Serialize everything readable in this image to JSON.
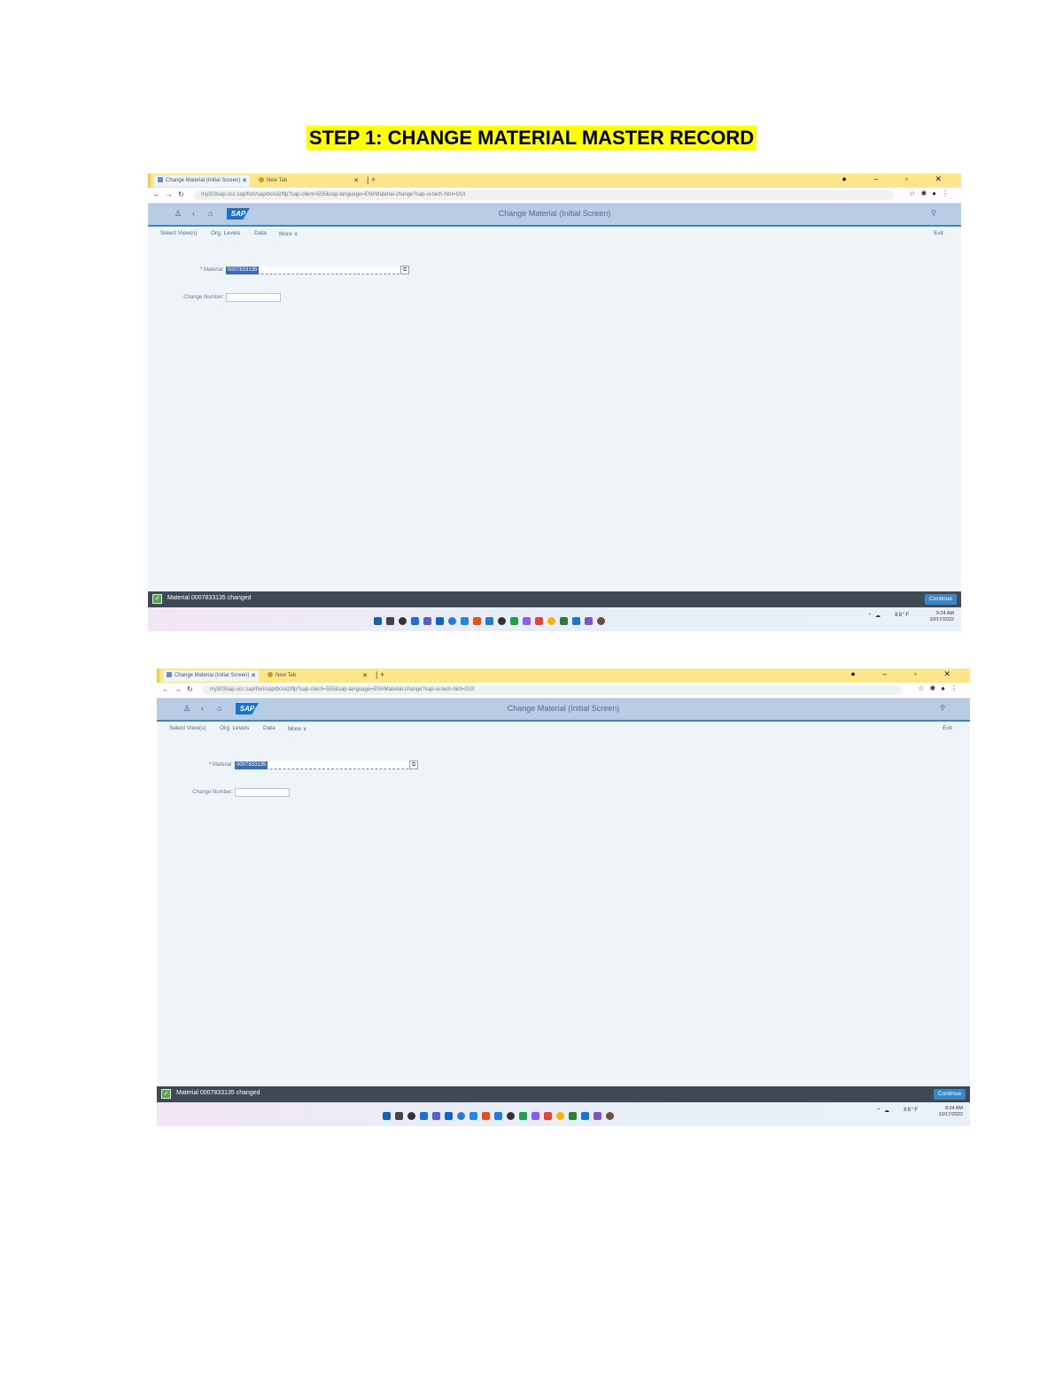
{
  "document": {
    "title": "STEP 1: CHANGE MATERIAL MASTER RECORD"
  },
  "screenshots": [
    {
      "browser": {
        "tab1": "Change Material (Initial Screen)",
        "tab2": "New Tab",
        "url": "my303sap.ucc.sap/fiori/sap/bc/ui2/flp?sap-client=555&sap-language=EN#Material-change?sap-ui-tech-hint=GUI"
      },
      "shell": {
        "title": "Change Material (Initial Screen)",
        "logo": "SAP"
      },
      "menu": {
        "items": [
          "Select View(s)",
          "Org. Levels",
          "Data",
          "More ∨"
        ],
        "exit": "Exit"
      },
      "form": {
        "material_label": "Material:",
        "material_value": "0007833135",
        "change_number_label": "Change Number:",
        "change_number_value": ""
      },
      "message": {
        "text": "Material 0007833135 changed",
        "button": "Continue"
      }
    },
    {
      "browser": {
        "tab1": "Change Material (Initial Screen)",
        "tab2": "New Tab",
        "url": "my303sap.ucc.sap/fiori/sap/bc/ui2/flp?sap-client=555&sap-language=EN#Material-change?sap-ui-tech-hint=GUI"
      },
      "shell": {
        "title": "Change Material (Initial Screen)",
        "logo": "SAP"
      },
      "menu": {
        "items": [
          "Select View(s)",
          "Org. Levels",
          "Data",
          "More ∨"
        ],
        "exit": "Exit"
      },
      "form": {
        "material_label": "Material:",
        "material_value": "0007833135",
        "change_number_label": "Change Number:",
        "change_number_value": ""
      },
      "message": {
        "text": "Material 0007833135 changed",
        "button": "Continue"
      }
    }
  ],
  "taskbar_icon_colors": [
    "#1a5fb4",
    "#444444",
    "#333333",
    "#1e6fd9",
    "#5b5fc7",
    "#0c64c9",
    "#2a7dd6",
    "#1e88e5",
    "#e8501a",
    "#1e7bd9",
    "#333333",
    "#1aa34a",
    "#8b5cf6",
    "#ea4335",
    "#f4b400",
    "#2e7d32",
    "#1976d2",
    "#7e57c2",
    "#6d4c41"
  ],
  "tray": {
    "weather": "88°F",
    "time": "9:24 AM",
    "date": "10/17/2022"
  }
}
